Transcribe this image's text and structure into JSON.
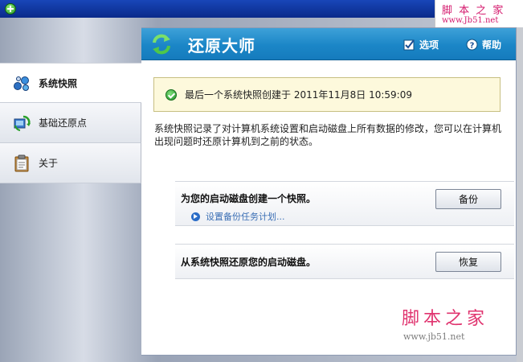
{
  "watermark": {
    "top_cn": "脚 本 之 家",
    "top_url": "www.Jb51.net",
    "bottom_cn": "脚本之家",
    "bottom_url": "www.jb51.net"
  },
  "header": {
    "title": "还原大师",
    "options_label": "选项",
    "help_label": "帮助",
    "options_icon": "checkbox-icon",
    "help_icon": "help-icon"
  },
  "sidebar": {
    "items": [
      {
        "label": "系统快照",
        "icon": "snapshot-icon",
        "active": true
      },
      {
        "label": "基础还原点",
        "icon": "restore-point-icon",
        "active": false
      },
      {
        "label": "关于",
        "icon": "clipboard-icon",
        "active": false
      }
    ]
  },
  "main": {
    "status_text": "最后一个系统快照创建于 2011年11月8日 10:59:09",
    "description": "系统快照记录了对计算机系统设置和启动磁盘上所有数据的修改，您可以在计算机出现问题时还原计算机到之前的状态。",
    "backup": {
      "label": "为您的启动磁盘创建一个快照。",
      "link": "设置备份任务计划...",
      "button": "备份"
    },
    "restore": {
      "label": "从系统快照还原您的启动磁盘。",
      "button": "恢复"
    }
  },
  "colors": {
    "header_blue": "#1b86c7",
    "banner_bg": "#fdf9dc",
    "link_blue": "#3b6fb5",
    "watermark_pink": "#d4186c"
  }
}
